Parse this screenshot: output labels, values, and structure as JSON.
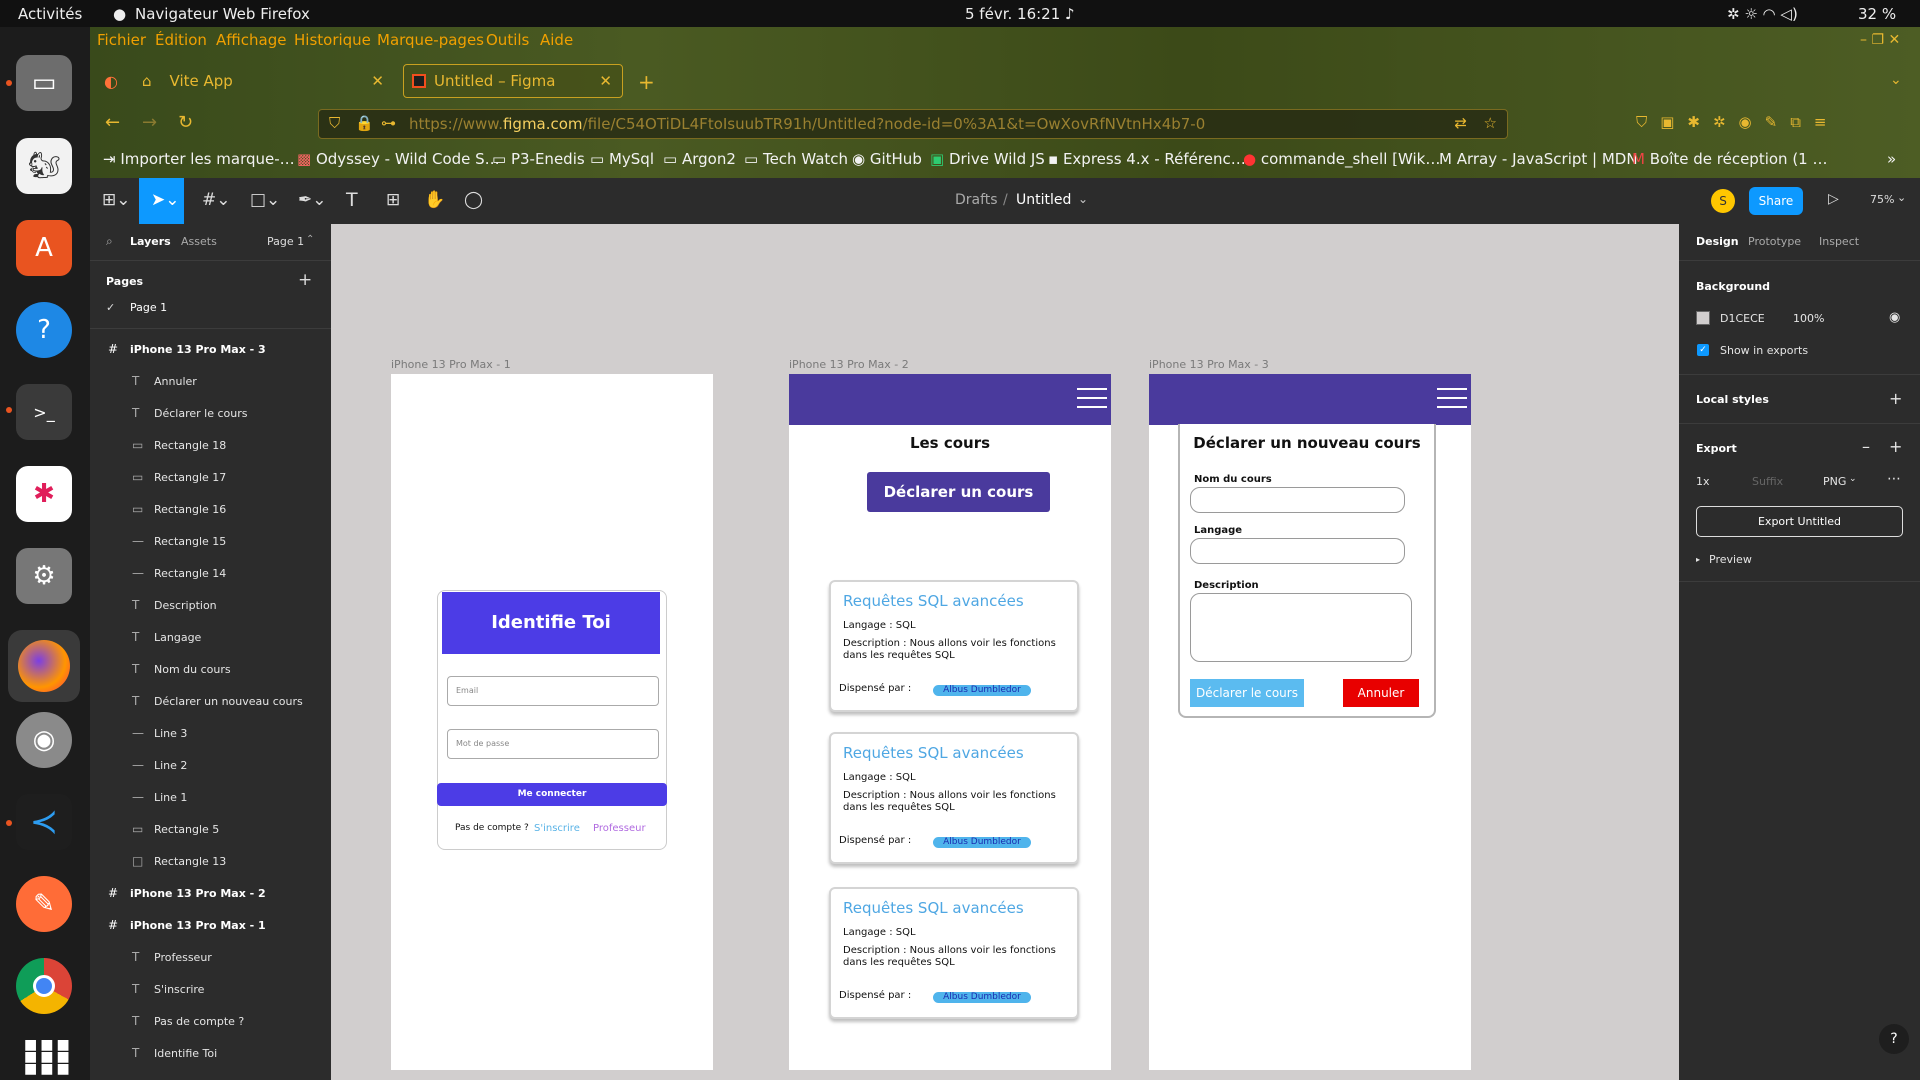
{
  "os": {
    "activities": "Activités",
    "window_title": "Navigateur Web Firefox",
    "datetime": "5 févr.  16:21",
    "battery": "32 %"
  },
  "menubar": [
    "Fichier",
    "Édition",
    "Affichage",
    "Historique",
    "Marque-pages",
    "Outils",
    "Aide"
  ],
  "tabs": [
    {
      "label": "Vite App"
    },
    {
      "label": "Untitled – Figma"
    }
  ],
  "url": {
    "prefix": "https://www.",
    "domain": "figma.com",
    "path": "/file/C54OTiDL4FtoIsuubTR91h/Untitled?node-id=0%3A1&t=OwXovRfNVtnHx4b7-0"
  },
  "bookmarks": [
    "Importer les marque-…",
    "Odyssey - Wild Code S…",
    "P3-Enedis",
    "MySql",
    "Argon2",
    "Tech Watch",
    "GitHub",
    "Drive Wild JS",
    "Express 4.x - Référenc…",
    "commande_shell [Wik…",
    "Array - JavaScript | MDN",
    "Boîte de réception (1 …"
  ],
  "figma": {
    "breadcrumb": {
      "drafts": "Drafts",
      "sep": "/",
      "file": "Untitled"
    },
    "avatar_letter": "S",
    "share": "Share",
    "zoom": "75%",
    "left_tabs": {
      "layers": "Layers",
      "assets": "Assets",
      "page": "Page 1"
    },
    "pages_title": "Pages",
    "current_page": "Page 1",
    "layers": [
      {
        "name": "iPhone 13 Pro Max - 3",
        "type": "frame"
      },
      {
        "name": "Annuler",
        "type": "text"
      },
      {
        "name": "Déclarer le cours",
        "type": "text"
      },
      {
        "name": "Rectangle 18",
        "type": "rect"
      },
      {
        "name": "Rectangle 17",
        "type": "rect"
      },
      {
        "name": "Rectangle 16",
        "type": "rect"
      },
      {
        "name": "Rectangle 15",
        "type": "line"
      },
      {
        "name": "Rectangle 14",
        "type": "line"
      },
      {
        "name": "Description",
        "type": "text"
      },
      {
        "name": "Langage",
        "type": "text"
      },
      {
        "name": "Nom du cours",
        "type": "text"
      },
      {
        "name": "Déclarer un nouveau cours",
        "type": "text"
      },
      {
        "name": "Line 3",
        "type": "line"
      },
      {
        "name": "Line 2",
        "type": "line"
      },
      {
        "name": "Line 1",
        "type": "line"
      },
      {
        "name": "Rectangle 5",
        "type": "rect"
      },
      {
        "name": "Rectangle 13",
        "type": "box"
      },
      {
        "name": "iPhone 13 Pro Max - 2",
        "type": "frame"
      },
      {
        "name": "iPhone 13 Pro Max - 1",
        "type": "frame"
      },
      {
        "name": "Professeur",
        "type": "text"
      },
      {
        "name": "S'inscrire",
        "type": "text"
      },
      {
        "name": "Pas de compte ?",
        "type": "text"
      },
      {
        "name": "Identifie Toi",
        "type": "text"
      }
    ],
    "right_tabs": {
      "design": "Design",
      "prototype": "Prototype",
      "inspect": "Inspect"
    },
    "background": {
      "title": "Background",
      "hex": "D1CECE",
      "opacity": "100%",
      "show_exports": "Show in exports"
    },
    "local_styles": "Local styles",
    "export": {
      "title": "Export",
      "scale": "1x",
      "suffix_placeholder": "Suffix",
      "format": "PNG",
      "button": "Export Untitled",
      "preview": "Preview"
    },
    "help": "?"
  },
  "frames": {
    "f1": {
      "label": "iPhone 13 Pro Max - 1",
      "title": "Identifie Toi",
      "email": "Email",
      "password": "Mot de passe",
      "login": "Me connecter",
      "no_account": "Pas de compte ?",
      "signup": "S'inscrire",
      "teacher": "Professeur"
    },
    "f2": {
      "label": "iPhone 13 Pro Max - 2",
      "heading": "Les cours",
      "button": "Déclarer un cours",
      "cards": [
        {
          "title": "Requêtes SQL avancées",
          "lang": "Langage : SQL",
          "desc1": "Description : Nous allons voir les fonctions",
          "desc2": "dans les requêtes SQL",
          "by": "Dispensé par :",
          "teacher": "Albus Dumbledor"
        },
        {
          "title": "Requêtes SQL avancées",
          "lang": "Langage : SQL",
          "desc1": "Description : Nous allons voir les fonctions",
          "desc2": "dans les requêtes SQL",
          "by": "Dispensé par :",
          "teacher": "Albus Dumbledor"
        },
        {
          "title": "Requêtes SQL avancées",
          "lang": "Langage : SQL",
          "desc1": "Description : Nous allons voir les fonctions",
          "desc2": "dans les requêtes SQL",
          "by": "Dispensé par :",
          "teacher": "Albus Dumbledor"
        }
      ]
    },
    "f3": {
      "label": "iPhone 13 Pro Max - 3",
      "title": "Déclarer un nouveau cours",
      "name_label": "Nom du cours",
      "lang_label": "Langage",
      "desc_label": "Description",
      "submit": "Déclarer le cours",
      "cancel": "Annuler"
    }
  },
  "colors": {
    "canvas": "#D1CECE",
    "primary": "#4A3A9D",
    "figma_blue": "#0D99FF",
    "cancel_red": "#E80000"
  }
}
